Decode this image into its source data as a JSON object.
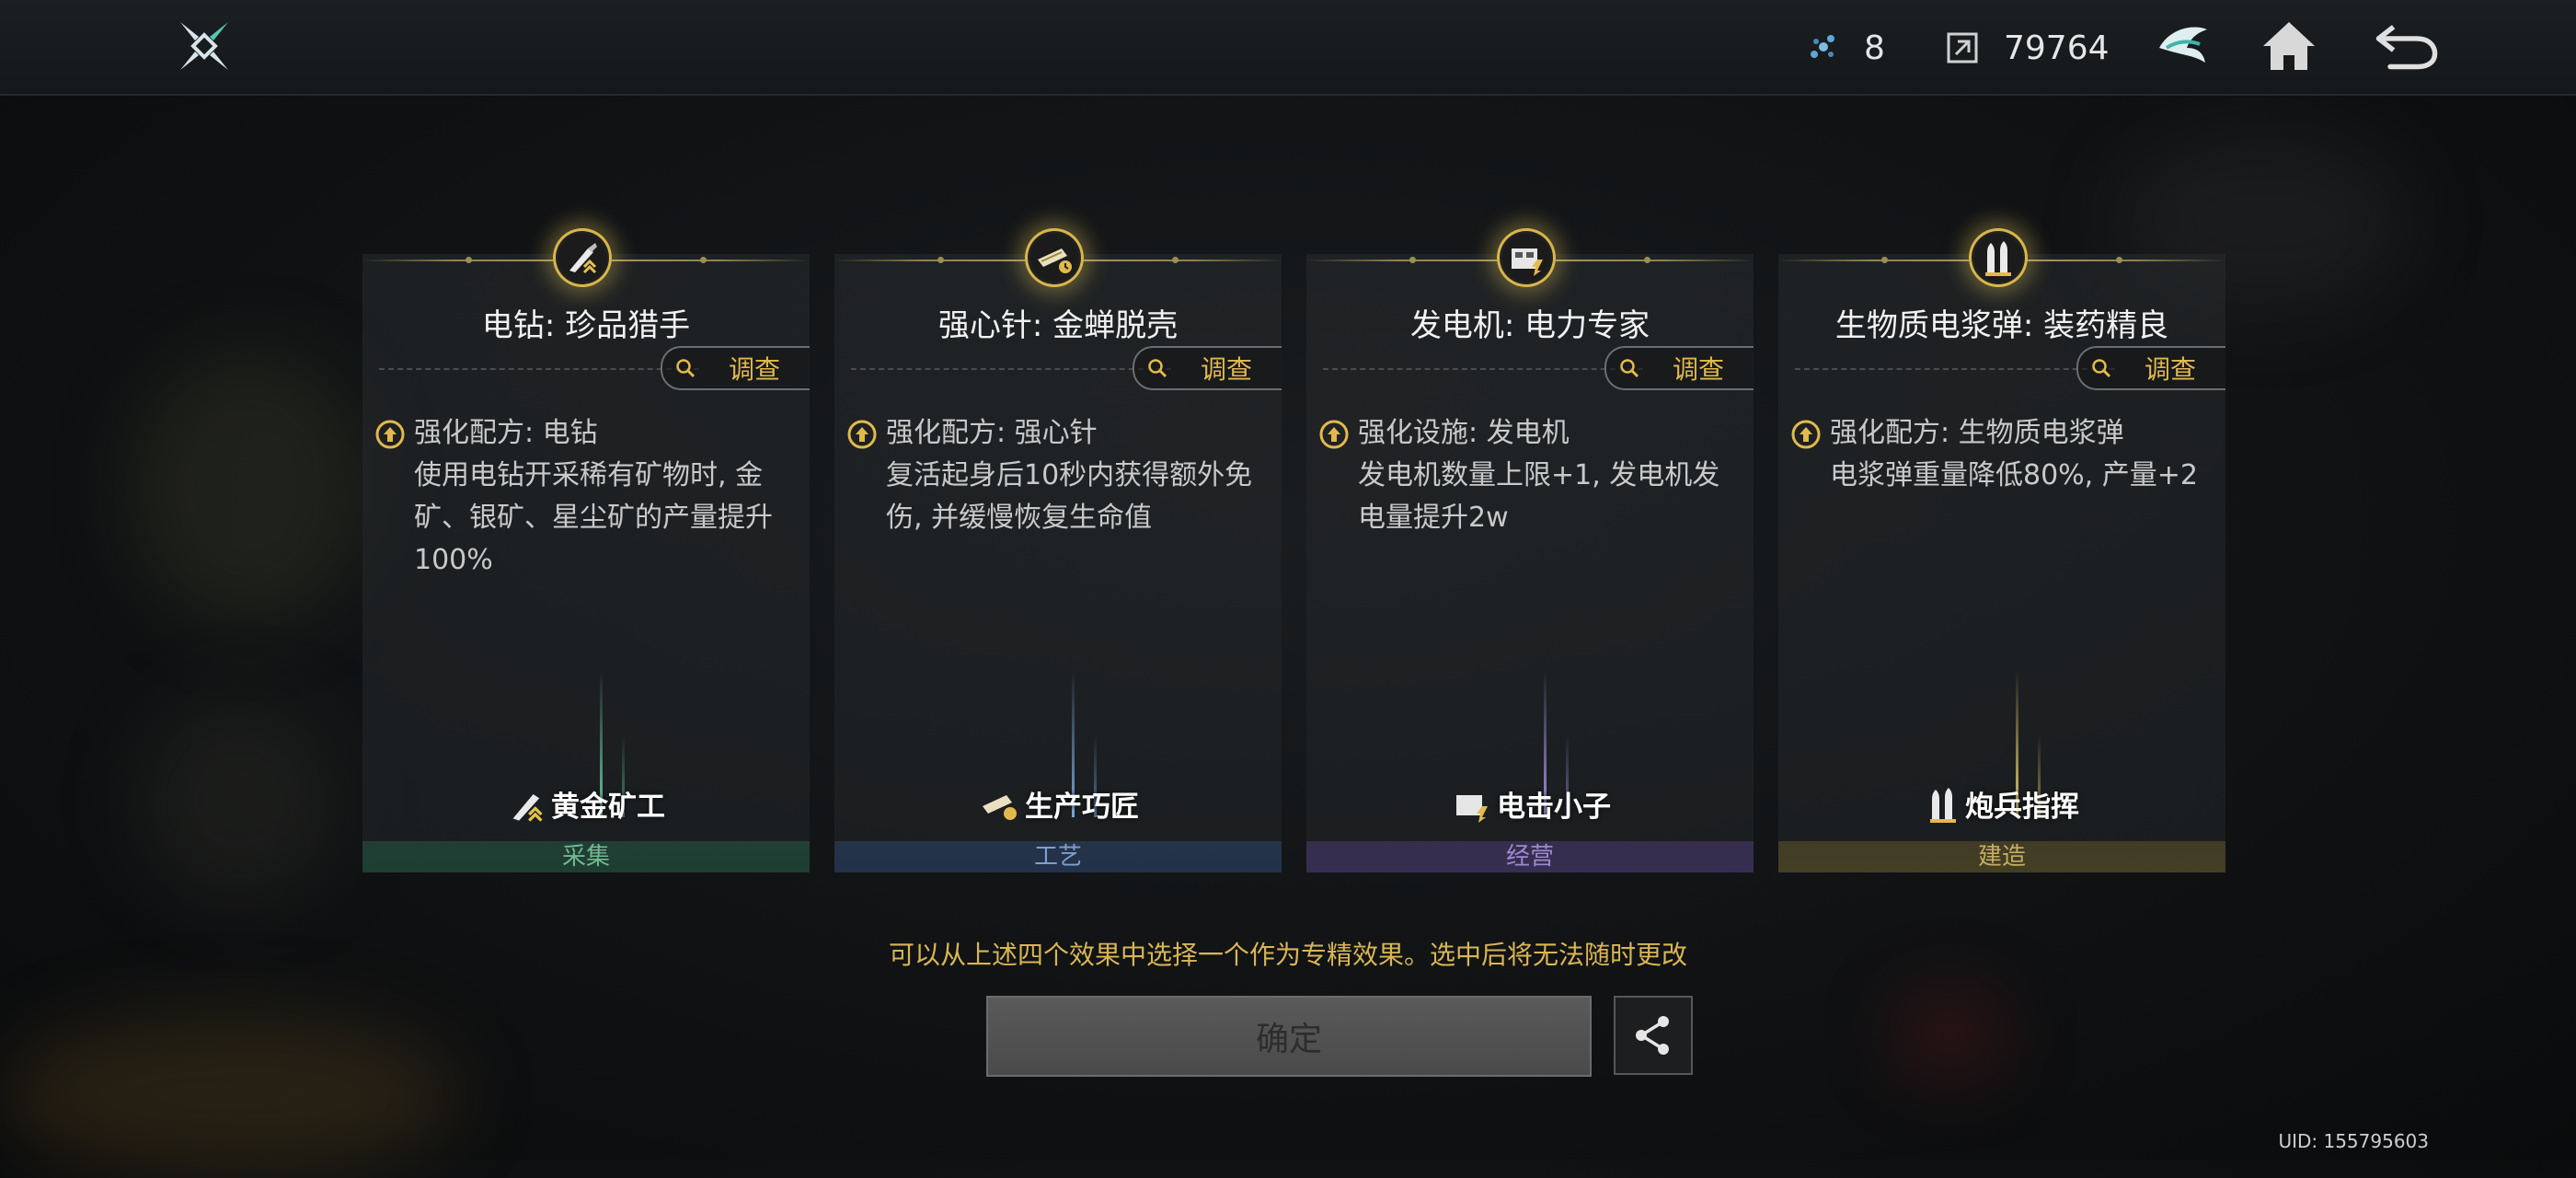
{
  "topbar": {
    "logo_icon": "game-logo-icon",
    "resource_1": {
      "icon": "crystal-icon",
      "value": "8"
    },
    "resource_2": {
      "icon": "currency-icon",
      "value": "79764"
    },
    "buttons": [
      "emblem-icon",
      "home-icon",
      "back-icon"
    ]
  },
  "cards": [
    {
      "title": "电钻: 珍品猎手",
      "inspect_label": "调查",
      "desc_head": "强化配方: 电钻",
      "desc_body": "使用电钻开采稀有矿物时, 金矿、银矿、星尘矿的产量提升100%",
      "role": "黄金矿工",
      "category": "采集",
      "category_color": "#4e8a6e",
      "beam_color": "#6ac9a0"
    },
    {
      "title": "强心针: 金蝉脱壳",
      "inspect_label": "调查",
      "desc_head": "强化配方: 强心针",
      "desc_body": "复活起身后10秒内获得额外免伤, 并缓慢恢复生命值",
      "role": "生产巧匠",
      "category": "工艺",
      "category_color": "#5a7aa8",
      "beam_color": "#7aa6e0"
    },
    {
      "title": "发电机: 电力专家",
      "inspect_label": "调查",
      "desc_head": "强化设施: 发电机",
      "desc_body": "发电机数量上限+1, 发电机发电量提升2w",
      "role": "电击小子",
      "category": "经营",
      "category_color": "#7a6aa8",
      "beam_color": "#a792e6"
    },
    {
      "title": "生物质电浆弹: 装药精良",
      "inspect_label": "调查",
      "desc_head": "强化配方: 生物质电浆弹",
      "desc_body": "电浆弹重量降低80%, 产量+2",
      "role": "炮兵指挥",
      "category": "建造",
      "category_color": "#9a8a4a",
      "beam_color": "#e6cf6a"
    }
  ],
  "hint": "可以从上述四个效果中选择一个作为专精效果。选中后将无法随时更改",
  "confirm_label": "确定",
  "uid": "UID: 155795603"
}
